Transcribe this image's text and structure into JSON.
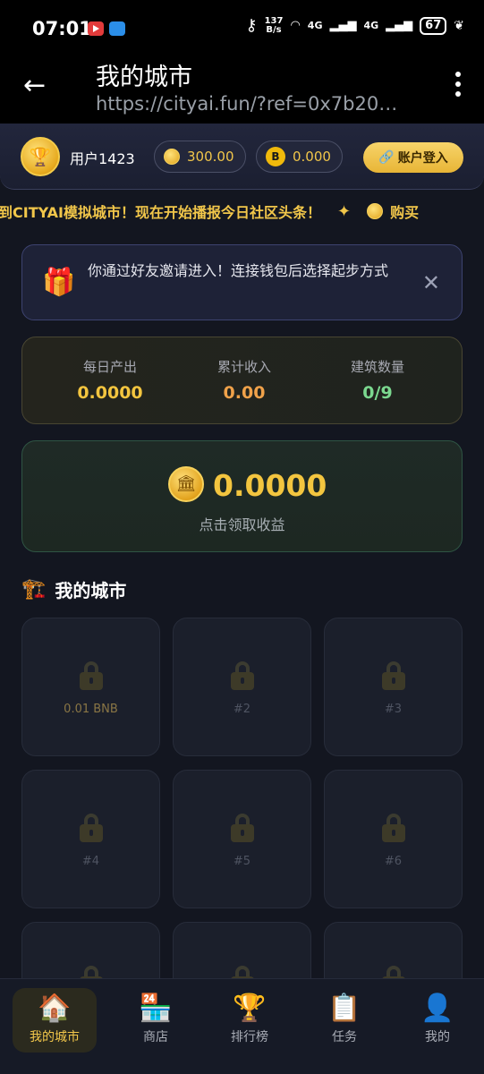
{
  "status_bar": {
    "time": "07:01",
    "speed_top": "137",
    "speed_bottom": "B/s",
    "signal1": "4G",
    "signal2": "4G",
    "battery": "67"
  },
  "app_bar": {
    "title": "我的城市",
    "url": "https://cityai.fun/?ref=0x7b20…"
  },
  "user": {
    "name": "用户1423",
    "coin_balance": "300.00",
    "bnb_balance": "0.000",
    "bnb_symbol": "B",
    "login_label": "账户登入"
  },
  "marquee": {
    "text": "到CITYAI模拟城市！现在开始播报今日社区头条！",
    "next_text": "购买"
  },
  "invite": {
    "message": "你通过好友邀请进入！连接钱包后选择起步方式"
  },
  "stats": [
    {
      "label": "每日产出",
      "value": "0.0000",
      "color": "#f3c53f"
    },
    {
      "label": "累计收入",
      "value": "0.00",
      "color": "#f0a24a"
    },
    {
      "label": "建筑数量",
      "value": "0/9",
      "color": "#7bd88f"
    }
  ],
  "claim": {
    "amount": "0.0000",
    "label": "点击领取收益"
  },
  "section": {
    "title": "我的城市"
  },
  "slots": [
    {
      "label": "0.01 BNB"
    },
    {
      "label": "#2"
    },
    {
      "label": "#3"
    },
    {
      "label": "#4"
    },
    {
      "label": "#5"
    },
    {
      "label": "#6"
    },
    {
      "label": ""
    },
    {
      "label": ""
    },
    {
      "label": ""
    }
  ],
  "nav": [
    {
      "label": "我的城市",
      "icon": "house-icon",
      "active": true
    },
    {
      "label": "商店",
      "icon": "store-icon",
      "active": false
    },
    {
      "label": "排行榜",
      "icon": "trophy-icon",
      "active": false
    },
    {
      "label": "任务",
      "icon": "clipboard-icon",
      "active": false
    },
    {
      "label": "我的",
      "icon": "user-icon",
      "active": false
    }
  ]
}
